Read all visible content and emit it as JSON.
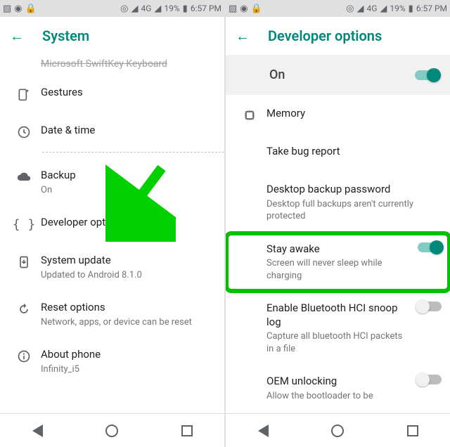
{
  "statusbar": {
    "clock": "6:57 PM",
    "battery": "19%",
    "network": "4G"
  },
  "left": {
    "title": "System",
    "cut_label": "Microsoft SwiftKey Keyboard",
    "items": [
      {
        "label": "Gestures",
        "sublabel": ""
      },
      {
        "label": "Date & time",
        "sublabel": ""
      },
      {
        "label": "Backup",
        "sublabel": "On"
      },
      {
        "label": "Developer options",
        "sublabel": ""
      },
      {
        "label": "System update",
        "sublabel": "Updated to Android 8.1.0"
      },
      {
        "label": "Reset options",
        "sublabel": "Network, apps, or device can be reset"
      },
      {
        "label": "About phone",
        "sublabel": "Infinity_i5"
      }
    ]
  },
  "right": {
    "title": "Developer options",
    "on_label": "On",
    "items": [
      {
        "label": "Memory",
        "sublabel": "",
        "toggle": null
      },
      {
        "label": "Take bug report",
        "sublabel": "",
        "toggle": null
      },
      {
        "label": "Desktop backup password",
        "sublabel": "Desktop full backups aren't currently protected",
        "toggle": null
      },
      {
        "label": "Stay awake",
        "sublabel": "Screen will never sleep while charging",
        "toggle": "on"
      },
      {
        "label": "Enable Bluetooth HCI snoop log",
        "sublabel": "Capture all bluetooth HCI packets in a file",
        "toggle": "off"
      },
      {
        "label": "OEM unlocking",
        "sublabel": "Allow the bootloader to be",
        "toggle": "off"
      }
    ]
  }
}
